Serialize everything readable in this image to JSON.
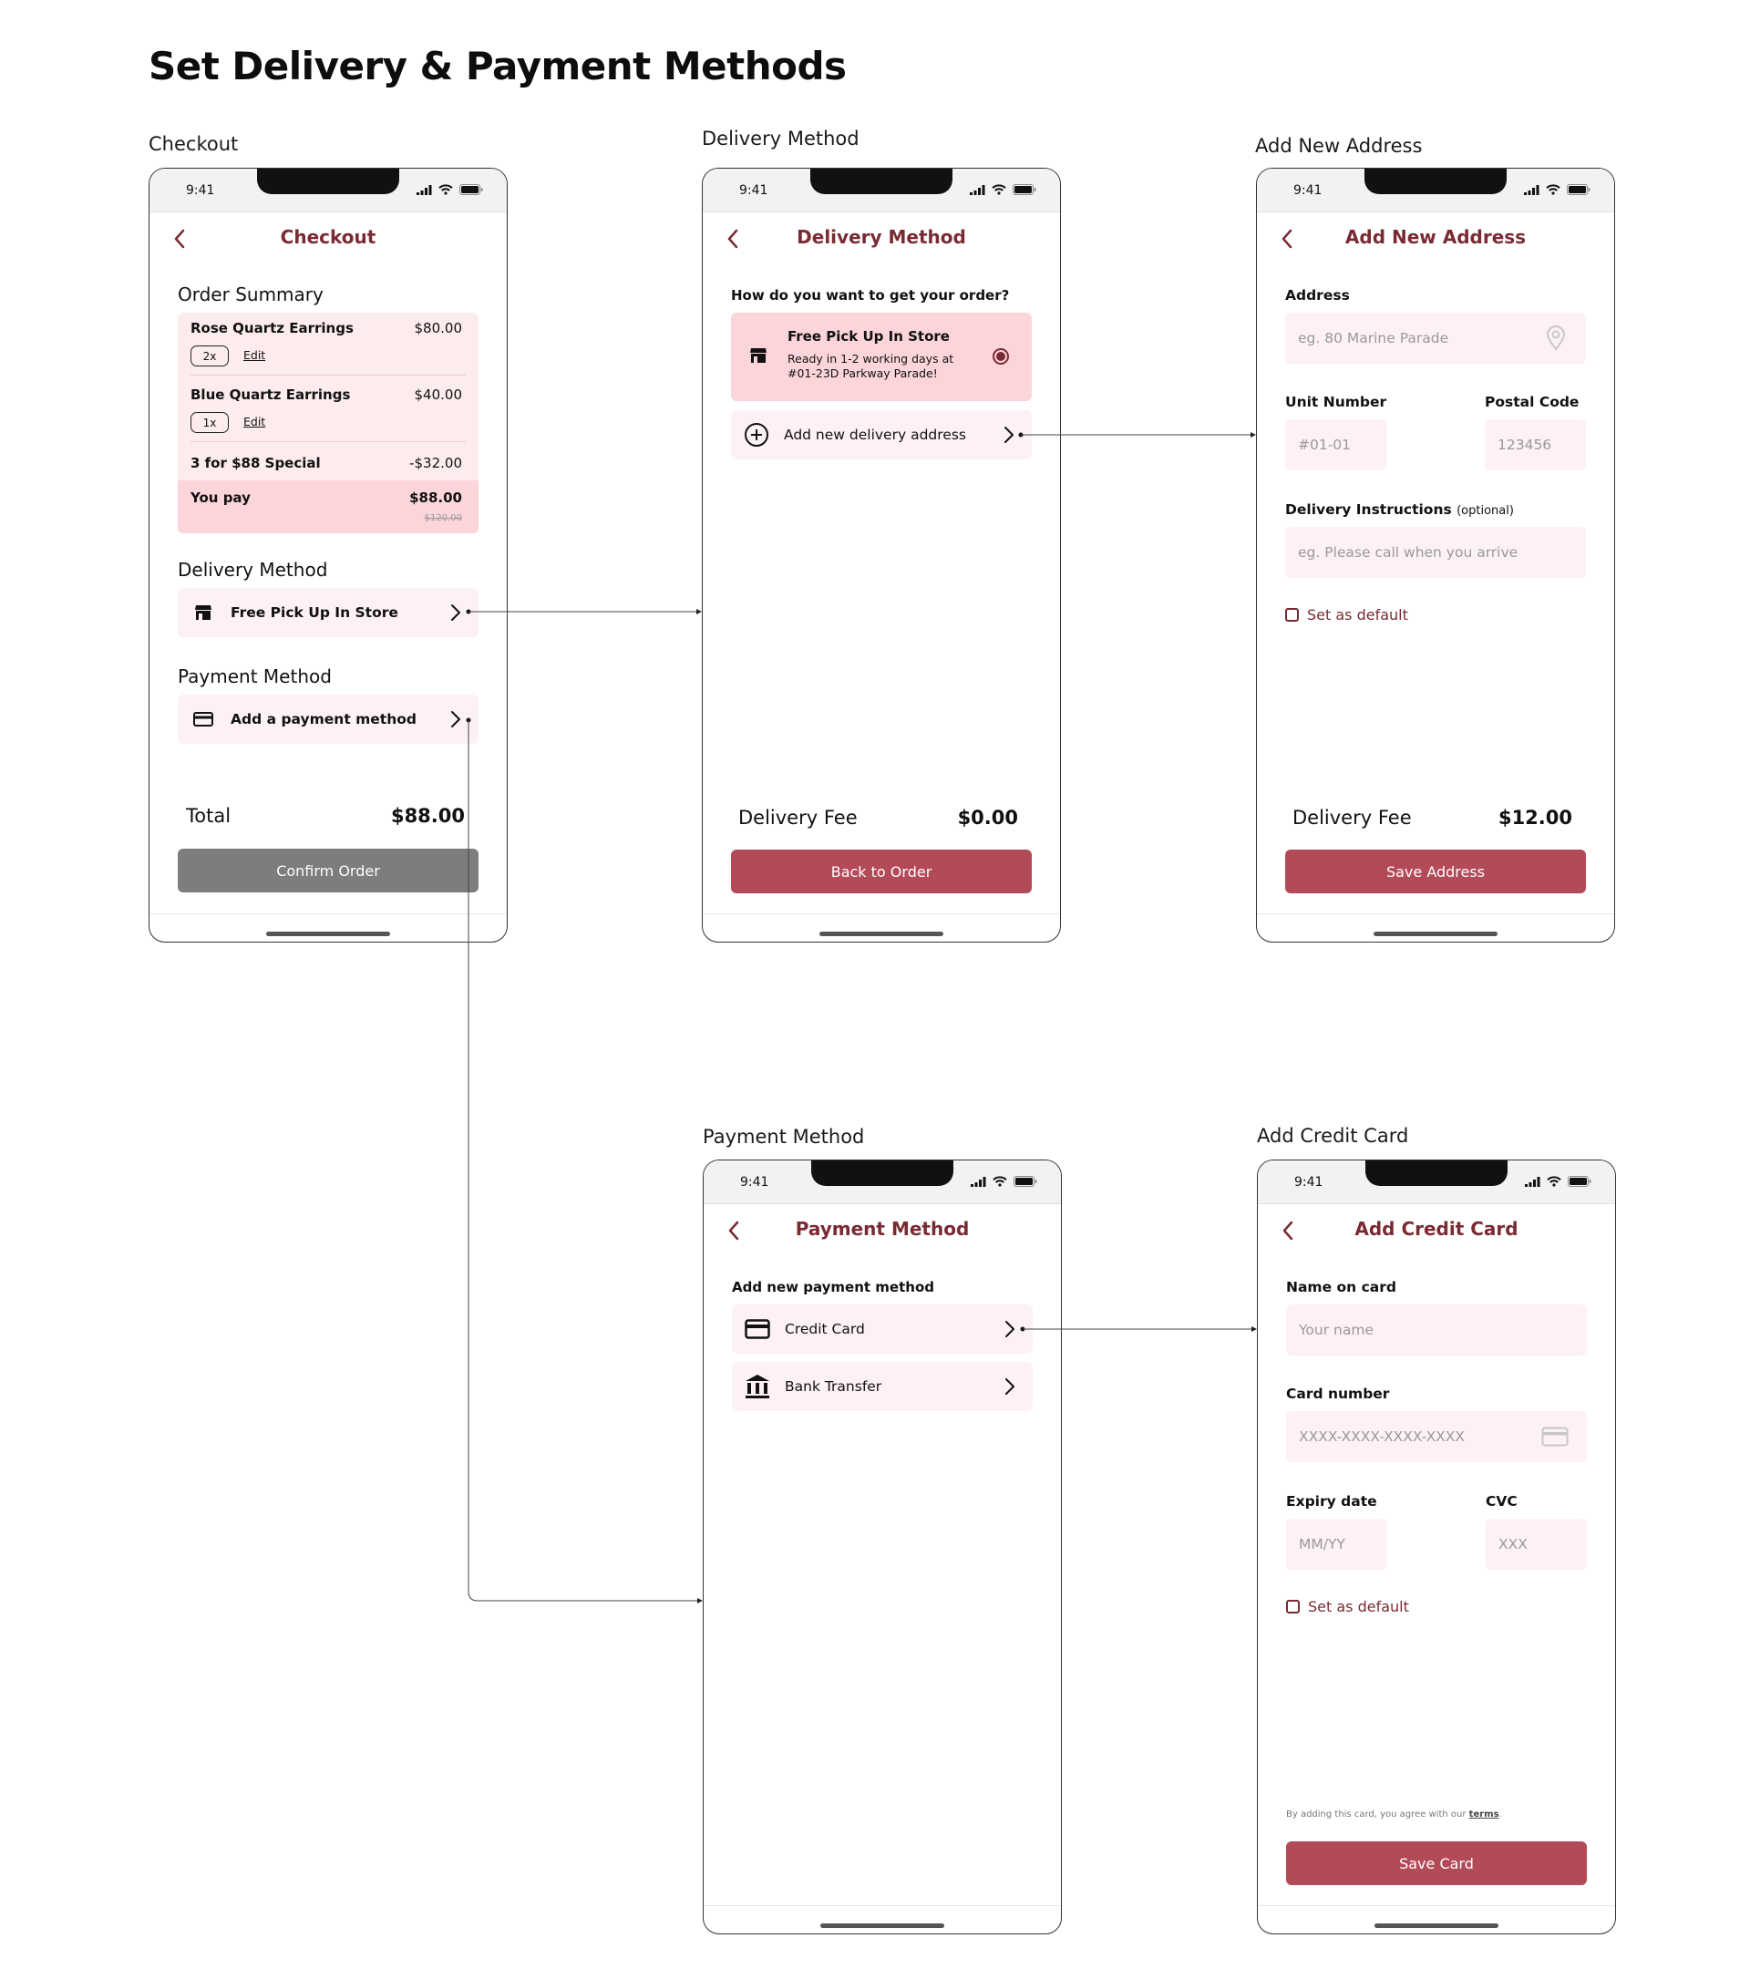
{
  "page": {
    "title": "Set Delivery & Payment Methods"
  },
  "status": {
    "time": "9:41"
  },
  "colors": {
    "accent": "#b34a58",
    "title_red": "#7a2a32",
    "pink_bg": "#fcecee",
    "selected_pink": "#fbd5da",
    "disabled_grey": "#7d7d7d"
  },
  "checkout": {
    "frame_label": "Checkout",
    "title": "Checkout",
    "order_summary_heading": "Order Summary",
    "items": [
      {
        "name": "Rose Quartz Earrings",
        "price": "$80.00",
        "qty": "2x",
        "edit": "Edit"
      },
      {
        "name": "Blue Quartz Earrings",
        "price": "$40.00",
        "qty": "1x",
        "edit": "Edit"
      }
    ],
    "promo": {
      "name": "3 for $88 Special",
      "amount": "-$32.00"
    },
    "you_pay": {
      "label": "You pay",
      "amount": "$88.00",
      "original": "$120.00"
    },
    "delivery_heading": "Delivery Method",
    "delivery_value": "Free Pick Up In Store",
    "payment_heading": "Payment Method",
    "payment_value": "Add a payment method",
    "total_label": "Total",
    "total_value": "$88.00",
    "confirm_button": "Confirm Order"
  },
  "delivery": {
    "frame_label": "Delivery Method",
    "title": "Delivery Method",
    "question": "How do you want to get your order?",
    "option_pickup": {
      "title": "Free Pick Up In Store",
      "desc1": "Ready in 1-2 working days at",
      "desc2": "#01-23D Parkway Parade!"
    },
    "add_address": "Add new delivery address",
    "fee_label": "Delivery Fee",
    "fee_value": "$0.00",
    "back_button": "Back to Order"
  },
  "address": {
    "frame_label": "Add New Address",
    "title": "Add New Address",
    "address_label": "Address",
    "address_placeholder": "eg. 80 Marine Parade",
    "unit_label": "Unit Number",
    "unit_placeholder": "#01-01",
    "postal_label": "Postal Code",
    "postal_placeholder": "123456",
    "instructions_label": "Delivery Instructions",
    "instructions_optional": "(optional)",
    "instructions_placeholder": "eg. Please call when you arrive",
    "default_label": "Set as default",
    "fee_label": "Delivery Fee",
    "fee_value": "$12.00",
    "save_button": "Save Address"
  },
  "payment": {
    "frame_label": "Payment Method",
    "title": "Payment Method",
    "heading": "Add new payment method",
    "options": [
      {
        "label": "Credit Card",
        "icon": "credit-card-icon"
      },
      {
        "label": "Bank Transfer",
        "icon": "bank-icon"
      }
    ]
  },
  "card": {
    "frame_label": "Add Credit Card",
    "title": "Add Credit Card",
    "name_label": "Name on card",
    "name_placeholder": "Your name",
    "number_label": "Card number",
    "number_placeholder": "XXXX-XXXX-XXXX-XXXX",
    "expiry_label": "Expiry date",
    "expiry_placeholder": "MM/YY",
    "cvc_label": "CVC",
    "cvc_placeholder": "XXX",
    "default_label": "Set as default",
    "terms_prefix": "By adding this card, you agree with our",
    "terms_link": "terms",
    "terms_suffix": ".",
    "save_button": "Save Card"
  }
}
